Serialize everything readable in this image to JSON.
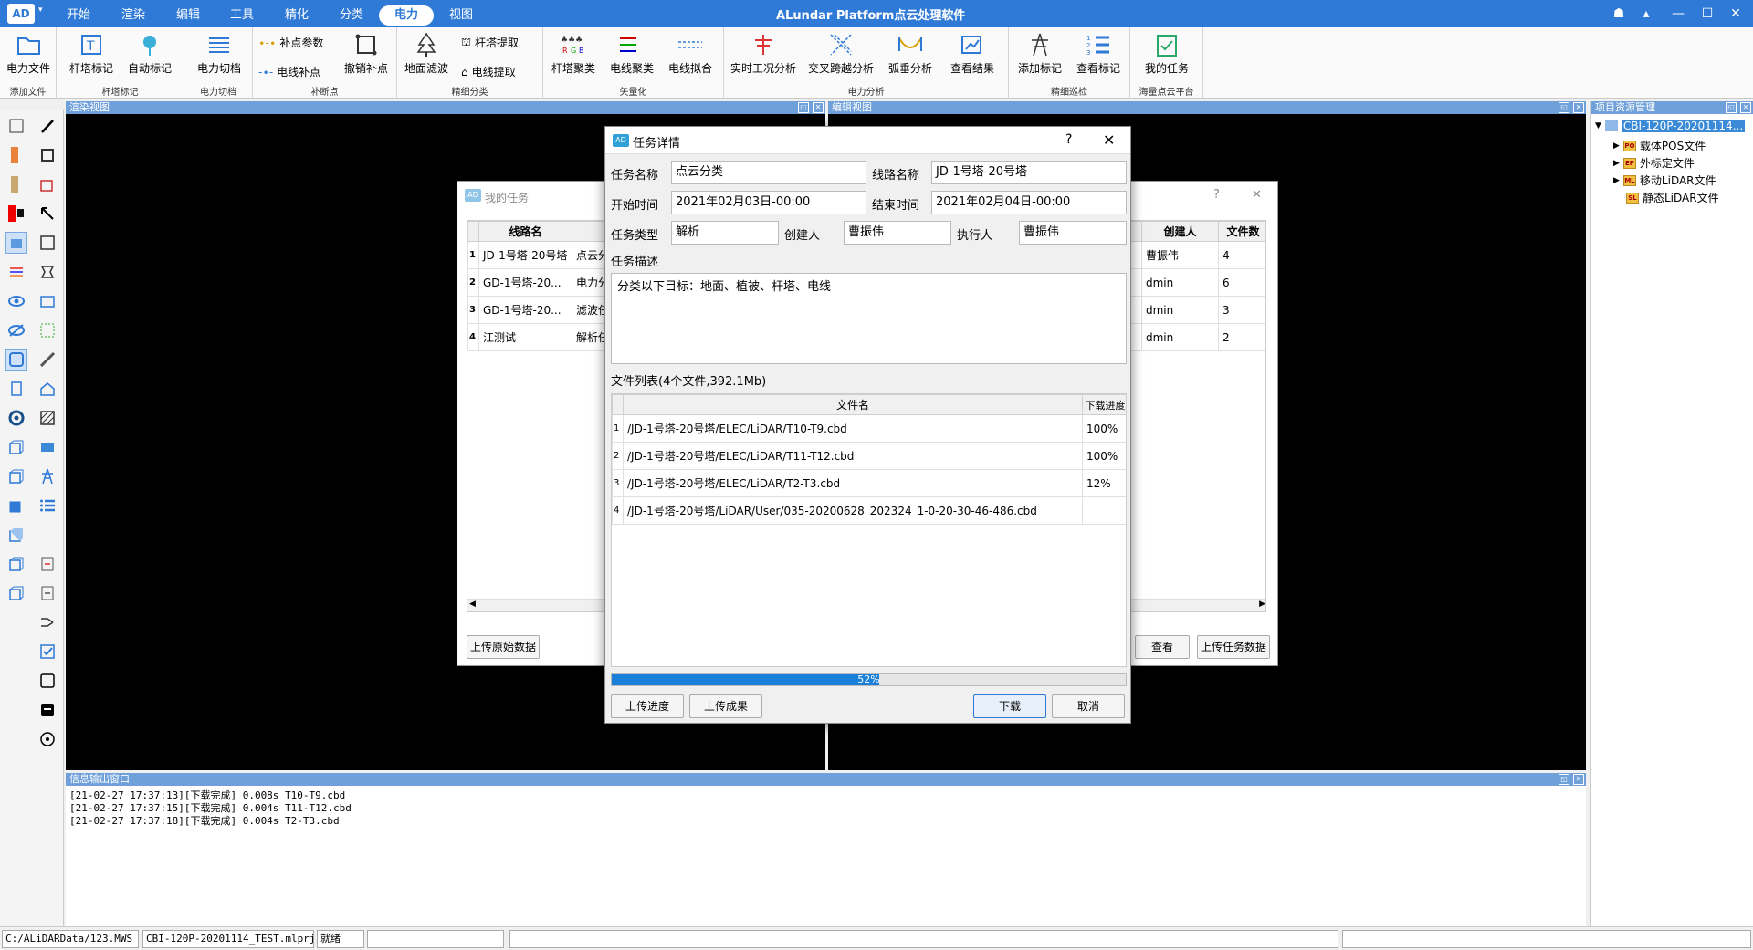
{
  "titlebar": {
    "logo": "AD",
    "app_title": "ALundar Platform点云处理软件",
    "menus": [
      "开始",
      "渲染",
      "编辑",
      "工具",
      "精化",
      "分类",
      "电力",
      "视图"
    ],
    "active_menu": "电力"
  },
  "ribbon": {
    "groups": {
      "add_file": "添加文件",
      "tower_mark": "杆塔标记",
      "power_cut": "电力切档",
      "patch_point": "补断点",
      "fine_class": "精细分类",
      "vector": "矢量化",
      "power_analysis": "电力分析",
      "inspection": "精细巡检",
      "cloud_platform": "海量点云平台"
    },
    "buttons": {
      "power_file": "电力文件",
      "tower_mark": "杆塔标记",
      "auto_mark": "自动标记",
      "power_cut": "电力切档",
      "patch_params": "补点参数",
      "line_patch": "电线补点",
      "undo_patch": "撤销补点",
      "ground_filter": "地面滤波",
      "tower_extract": "杆塔提取",
      "line_extract": "电线提取",
      "tower_cluster": "杆塔聚类",
      "line_cluster": "电线聚类",
      "line_fit": "电线拟合",
      "realtime_analysis": "实时工况分析",
      "cross_analysis": "交叉跨越分析",
      "sag_analysis": "弧垂分析",
      "view_results": "查看结果",
      "add_mark": "添加标记",
      "view_mark": "查看标记",
      "my_tasks": "我的任务"
    }
  },
  "panels": {
    "render": "渲染视图",
    "edit": "编辑视图",
    "project": "项目资源管理",
    "info": "信息输出窗口"
  },
  "project_tree": {
    "root": "CBI-120P-20201114...",
    "children": [
      {
        "icon": "PO",
        "label": "载体POS文件"
      },
      {
        "icon": "EP",
        "label": "外标定文件"
      },
      {
        "icon": "ML",
        "label": "移动LiDAR文件"
      },
      {
        "icon": "SL",
        "label": "静态LiDAR文件"
      }
    ]
  },
  "log": [
    "[21-02-27 17:37:13][下载完成] 0.008s T10-T9.cbd",
    "[21-02-27 17:37:15][下载完成] 0.004s T11-T12.cbd",
    "[21-02-27 17:37:18][下载完成] 0.004s T2-T3.cbd"
  ],
  "statusbar": {
    "path": "C:/ALiDARData/123.MWS",
    "project": "CBI-120P-20201114_TEST.mlprj",
    "state": "就绪"
  },
  "mytasks": {
    "title": "我的任务",
    "help": "?",
    "close": "✕",
    "columns": {
      "line": "线路名",
      "creator": "创建人",
      "files": "文件数"
    },
    "rows": [
      {
        "line": "JD-1号塔-20号塔",
        "type": "点云分",
        "creator": "曹振伟",
        "files": "4"
      },
      {
        "line": "GD-1号塔-20...",
        "type": "电力分",
        "creator": "dmin",
        "files": "6"
      },
      {
        "line": "GD-1号塔-20...",
        "type": "滤波任",
        "creator": "dmin",
        "files": "3"
      },
      {
        "line": "江测试",
        "type": "解析任",
        "creator": "dmin",
        "files": "2"
      }
    ],
    "buttons": {
      "upload_raw": "上传原始数据",
      "view": "查看",
      "upload_task": "上传任务数据"
    }
  },
  "dialog": {
    "title": "任务详情",
    "help": "?",
    "close": "✕",
    "labels": {
      "task_name": "任务名称",
      "line_name": "线路名称",
      "start_time": "开始时间",
      "end_time": "结束时间",
      "task_type": "任务类型",
      "creator": "创建人",
      "executor": "执行人",
      "description": "任务描述",
      "file_list": "文件列表(4个文件,392.1Mb)"
    },
    "values": {
      "task_name": "点云分类",
      "line_name": "JD-1号塔-20号塔",
      "start_time": "2021年02月03日-00:00",
      "end_time": "2021年02月04日-00:00",
      "task_type": "解析",
      "creator": "曹振伟",
      "executor": "曹振伟",
      "description": "分类以下目标：地面、植被、杆塔、电线"
    },
    "file_columns": {
      "name": "文件名",
      "progress": "下载进度"
    },
    "files": [
      {
        "name": "/JD-1号塔-20号塔/ELEC/LiDAR/T10-T9.cbd",
        "progress": "100%"
      },
      {
        "name": "/JD-1号塔-20号塔/ELEC/LiDAR/T11-T12.cbd",
        "progress": "100%"
      },
      {
        "name": "/JD-1号塔-20号塔/ELEC/LiDAR/T2-T3.cbd",
        "progress": "12%"
      },
      {
        "name": "/JD-1号塔-20号塔/LiDAR/User/035-20200628_202324_1-0-20-30-46-486.cbd",
        "progress": ""
      }
    ],
    "overall_progress": 52,
    "overall_progress_label": "52%",
    "buttons": {
      "upload_progress": "上传进度",
      "upload_results": "上传成果",
      "download": "下载",
      "cancel": "取消"
    }
  },
  "colors": {
    "accent": "#2f7ad6",
    "panel_header": "#6fa0d9",
    "progress": "#1a7fd8"
  }
}
